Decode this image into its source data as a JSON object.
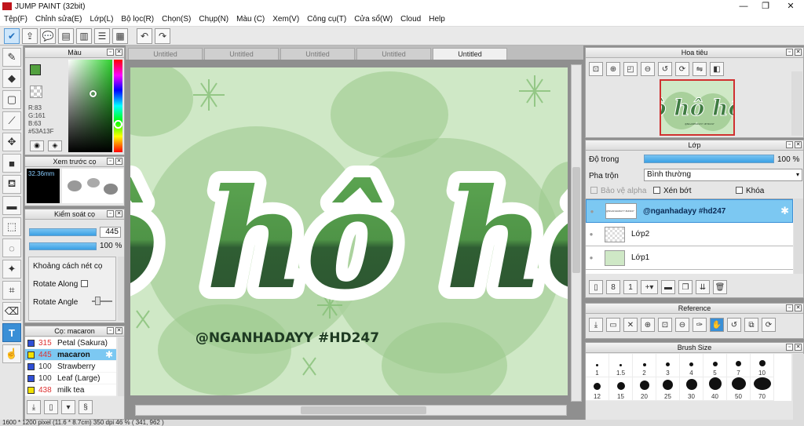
{
  "window": {
    "title": "JUMP PAINT (32bit)",
    "controls": [
      "—",
      "❐",
      "✕"
    ]
  },
  "menu": [
    "Tệp(F)",
    "Chỉnh sửa(E)",
    "Lớp(L)",
    "Bộ lọc(R)",
    "Chọn(S)",
    "Chụp(N)",
    "Màu (C)",
    "Xem(V)",
    "Công cụ(T)",
    "Cửa sổ(W)",
    "Cloud",
    "Help"
  ],
  "color_panel": {
    "title": "Màu",
    "r": "R:83",
    "g": "G:161",
    "b": "B:63",
    "hex": "#53A13F",
    "fg_color": "#53a13f",
    "bg_color": "#ffffff"
  },
  "brush_preview": {
    "title": "Xem trước cọ",
    "size": "32.36mm"
  },
  "brush_control": {
    "title": "Kiểm soát cọ",
    "size_value": "445",
    "opacity_value": "100 %",
    "options": [
      "Khoảng cách nét cọ",
      "Rotate Along",
      "Rotate Angle"
    ]
  },
  "brush_list": {
    "title": "Cọ: macaron",
    "items": [
      {
        "num": "315",
        "name": "Petal (Sakura)",
        "color": "#2f4fd6",
        "red": true
      },
      {
        "num": "445",
        "name": "macaron",
        "color": "#f2e200",
        "red": true,
        "selected": true
      },
      {
        "num": "100",
        "name": "Strawberry",
        "color": "#2f4fd6",
        "red": false
      },
      {
        "num": "100",
        "name": "Leaf (Large)",
        "color": "#2f4fd6",
        "red": false
      },
      {
        "num": "438",
        "name": "milk tea",
        "color": "#f2e200",
        "red": true
      }
    ]
  },
  "tabs": [
    "Untitled",
    "Untitled",
    "Untitled",
    "Untitled",
    "Untitled"
  ],
  "artwork": {
    "main_text": "ô hô hô",
    "credit": "@NGANHADAYY #HD247",
    "tiny_credit": "@NGANHADAYY #HD247"
  },
  "navigator": {
    "title": "Hoa tiêu"
  },
  "layers": {
    "title": "Lớp",
    "opacity_label": "Độ trong",
    "opacity_value": "100 %",
    "blend_label": "Pha trộn",
    "blend_value": "Bình thường",
    "protect_alpha": "Bảo vệ alpha",
    "clip": "Xén bớt",
    "lock": "Khóa",
    "rows": [
      {
        "name": "@nganhadayy #hd247",
        "selected": true
      },
      {
        "name": "Lớp2",
        "selected": false
      },
      {
        "name": "Lớp1",
        "selected": false
      }
    ]
  },
  "reference": {
    "title": "Reference"
  },
  "brush_size": {
    "title": "Brush Size",
    "sizes": [
      "1",
      "1.5",
      "2",
      "3",
      "4",
      "5",
      "7",
      "10",
      "12",
      "15",
      "20",
      "25",
      "30",
      "40",
      "50",
      "70"
    ]
  },
  "status": "1600 * 1200 pixel  (11.6 * 8.7cm)  350 dpi  46 %  ( 341, 962 )"
}
